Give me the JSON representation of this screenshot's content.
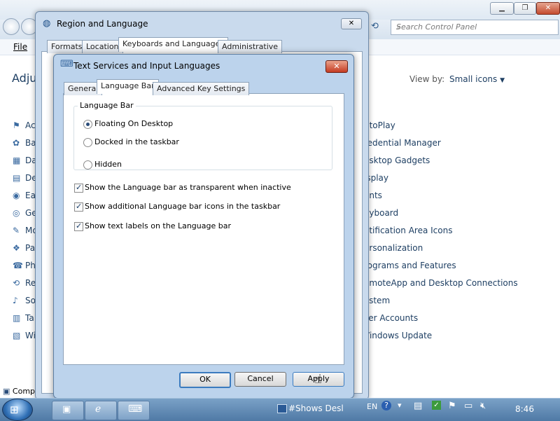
{
  "control_panel": {
    "search_placeholder": "Search Control Panel",
    "menu_file": "File",
    "heading_partial": "Adju",
    "view_by_label": "View by:",
    "view_by_value": "Small icons",
    "left_items": [
      "Ac",
      "Ba",
      "Da",
      "De",
      "Ea",
      "Ge",
      "Mo",
      "Pa",
      "Ph",
      "Re",
      "So",
      "Ta",
      "Wi"
    ],
    "right_items": [
      "utoPlay",
      "redential Manager",
      "esktop Gadgets",
      "isplay",
      "onts",
      "eyboard",
      "otification Area Icons",
      "ersonalization",
      "rograms and Features",
      "emoteApp and Desktop Connections",
      "ystem",
      "ser Accounts",
      "Vindows Update"
    ],
    "status_partial": "Comp"
  },
  "region_dialog": {
    "title": "Region and Language",
    "tabs": [
      "Formats",
      "Location",
      "Keyboards and Languages",
      "Administrative"
    ],
    "active_tab": "Keyboards and Languages"
  },
  "tsf_dialog": {
    "title": "Text Services and Input Languages",
    "close_symbol": "✕",
    "tabs": [
      "General",
      "Language Bar",
      "Advanced Key Settings"
    ],
    "active_tab": "Language Bar",
    "group_label": "Language Bar",
    "radios": [
      "Floating On Desktop",
      "Docked in the taskbar",
      "Hidden"
    ],
    "selected_radio": "Floating On Desktop",
    "checkboxes": [
      {
        "label": "Show the Language bar as transparent when inactive",
        "checked": true
      },
      {
        "label": "Show additional Language bar icons in the taskbar",
        "checked": true
      },
      {
        "label": "Show text labels on the Language bar",
        "checked": true
      }
    ],
    "buttons": {
      "ok": "OK",
      "cancel": "Cancel",
      "apply": "Apply"
    }
  },
  "taskbar": {
    "language_bar_text": "#Shows Desl",
    "language_code": "EN",
    "clock": "8:46"
  },
  "colors": {
    "dialog_frame": "#bcd3ec",
    "taskbar": "#4f79a5",
    "link_text": "#1e3f63"
  }
}
